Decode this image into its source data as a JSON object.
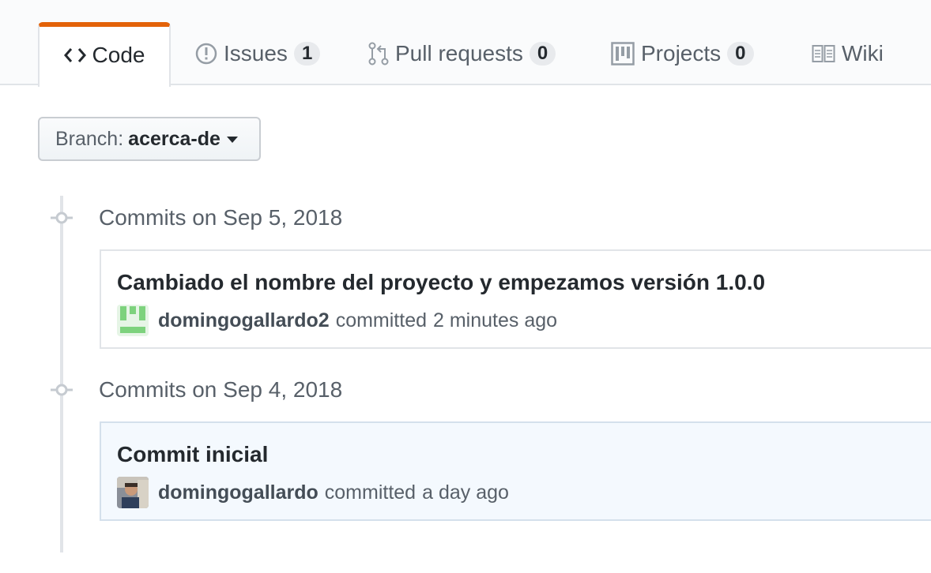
{
  "tabs": [
    {
      "label": "Code",
      "icon": "code-icon",
      "selected": true
    },
    {
      "label": "Issues",
      "icon": "issue-opened-icon",
      "count": "1"
    },
    {
      "label": "Pull requests",
      "icon": "git-pull-request-icon",
      "count": "0"
    },
    {
      "label": "Projects",
      "icon": "project-icon",
      "count": "0"
    },
    {
      "label": "Wiki",
      "icon": "book-icon"
    }
  ],
  "branch": {
    "label": "Branch:",
    "value": "acerca-de"
  },
  "groups": [
    {
      "heading": "Commits on Sep 5, 2018",
      "commit": {
        "title": "Cambiado el nombre del proyecto y empezamos versión 1.0.0",
        "author": "domingogallardo2",
        "action": "committed",
        "time": "2 minutes ago"
      }
    },
    {
      "heading": "Commits on Sep 4, 2018",
      "commit": {
        "title": "Commit inicial",
        "author": "domingogallardo",
        "action": "committed",
        "time": "a day ago"
      }
    }
  ],
  "colors": {
    "accent": "#e36209",
    "highlight": "#f4f9fe"
  }
}
